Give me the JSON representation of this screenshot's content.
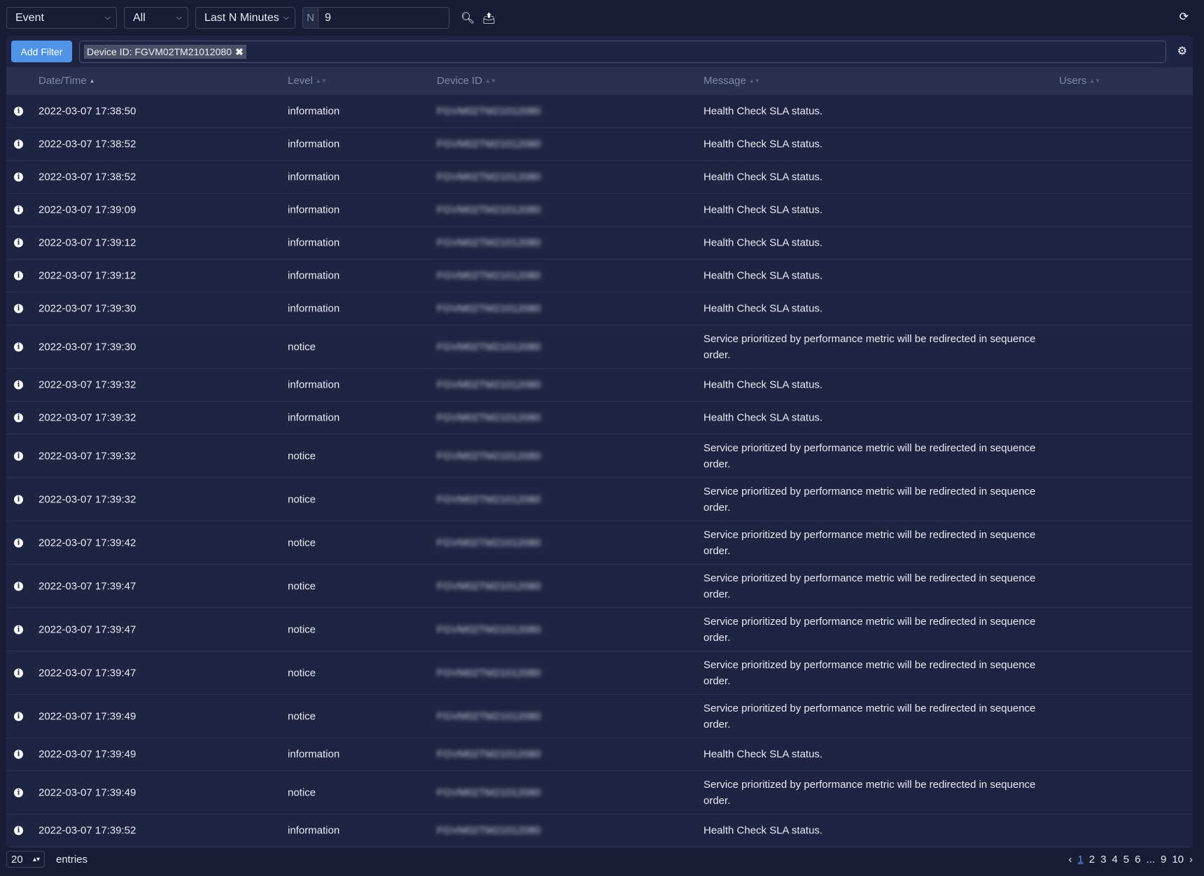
{
  "toolbar": {
    "log_type": "Event",
    "subtype": "All",
    "time_mode": "Last N Minutes",
    "n_prefix": "N",
    "n_value": "9"
  },
  "filter": {
    "add_label": "Add Filter",
    "chip": "Device ID: FGVM02TM21012080"
  },
  "columns": [
    "Date/Time",
    "Level",
    "Device ID",
    "Message",
    "Users"
  ],
  "rows": [
    {
      "date": "2022-03-07 17:38:50",
      "level": "information",
      "device": "FGVM02TM21012080",
      "message": "Health Check SLA status."
    },
    {
      "date": "2022-03-07 17:38:52",
      "level": "information",
      "device": "FGVM02TM21012080",
      "message": "Health Check SLA status."
    },
    {
      "date": "2022-03-07 17:38:52",
      "level": "information",
      "device": "FGVM02TM21012080",
      "message": "Health Check SLA status."
    },
    {
      "date": "2022-03-07 17:39:09",
      "level": "information",
      "device": "FGVM02TM21012080",
      "message": "Health Check SLA status."
    },
    {
      "date": "2022-03-07 17:39:12",
      "level": "information",
      "device": "FGVM02TM21012080",
      "message": "Health Check SLA status."
    },
    {
      "date": "2022-03-07 17:39:12",
      "level": "information",
      "device": "FGVM02TM21012080",
      "message": "Health Check SLA status."
    },
    {
      "date": "2022-03-07 17:39:30",
      "level": "information",
      "device": "FGVM02TM21012080",
      "message": "Health Check SLA status."
    },
    {
      "date": "2022-03-07 17:39:30",
      "level": "notice",
      "device": "FGVM02TM21012080",
      "message": "Service prioritized by performance metric will be redirected in sequence order."
    },
    {
      "date": "2022-03-07 17:39:32",
      "level": "information",
      "device": "FGVM02TM21012080",
      "message": "Health Check SLA status."
    },
    {
      "date": "2022-03-07 17:39:32",
      "level": "information",
      "device": "FGVM02TM21012080",
      "message": "Health Check SLA status."
    },
    {
      "date": "2022-03-07 17:39:32",
      "level": "notice",
      "device": "FGVM02TM21012080",
      "message": "Service prioritized by performance metric will be redirected in sequence order."
    },
    {
      "date": "2022-03-07 17:39:32",
      "level": "notice",
      "device": "FGVM02TM21012080",
      "message": "Service prioritized by performance metric will be redirected in sequence order."
    },
    {
      "date": "2022-03-07 17:39:42",
      "level": "notice",
      "device": "FGVM02TM21012080",
      "message": "Service prioritized by performance metric will be redirected in sequence order."
    },
    {
      "date": "2022-03-07 17:39:47",
      "level": "notice",
      "device": "FGVM02TM21012080",
      "message": "Service prioritized by performance metric will be redirected in sequence order."
    },
    {
      "date": "2022-03-07 17:39:47",
      "level": "notice",
      "device": "FGVM02TM21012080",
      "message": "Service prioritized by performance metric will be redirected in sequence order."
    },
    {
      "date": "2022-03-07 17:39:47",
      "level": "notice",
      "device": "FGVM02TM21012080",
      "message": "Service prioritized by performance metric will be redirected in sequence order."
    },
    {
      "date": "2022-03-07 17:39:49",
      "level": "notice",
      "device": "FGVM02TM21012080",
      "message": "Service prioritized by performance metric will be redirected in sequence order."
    },
    {
      "date": "2022-03-07 17:39:49",
      "level": "information",
      "device": "FGVM02TM21012080",
      "message": "Health Check SLA status."
    },
    {
      "date": "2022-03-07 17:39:49",
      "level": "notice",
      "device": "FGVM02TM21012080",
      "message": "Service prioritized by performance metric will be redirected in sequence order."
    },
    {
      "date": "2022-03-07 17:39:52",
      "level": "information",
      "device": "FGVM02TM21012080",
      "message": "Health Check SLA status."
    }
  ],
  "footer": {
    "page_size": "20",
    "entries_label": "entries",
    "pages": [
      "1",
      "2",
      "3",
      "4",
      "5",
      "6",
      "...",
      "9",
      "10"
    ],
    "current_page": "1"
  }
}
